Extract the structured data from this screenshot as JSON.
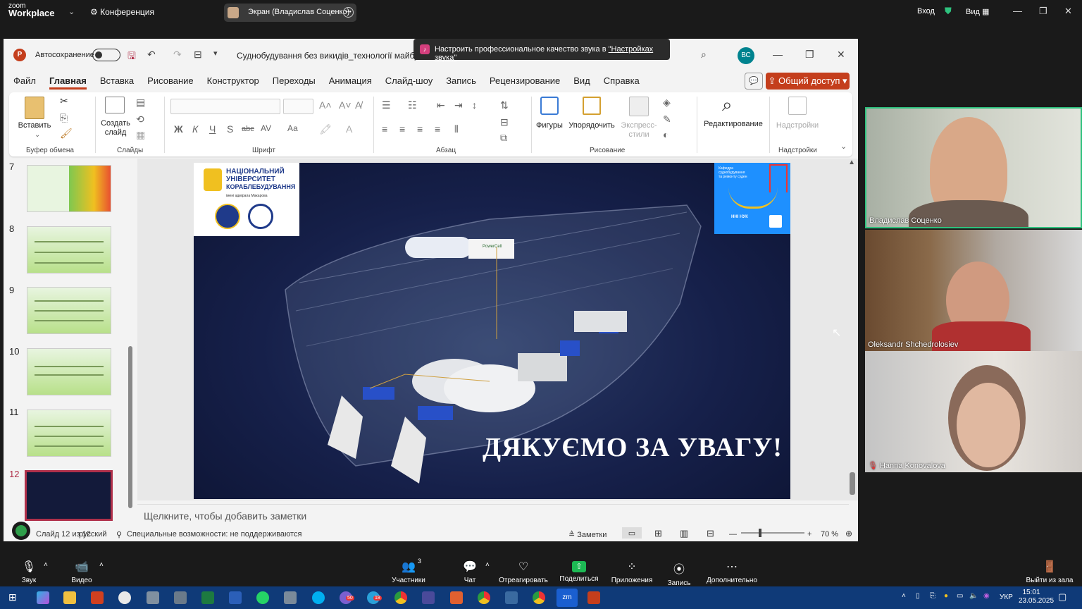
{
  "zoom": {
    "logo_top": "zoom",
    "logo_bottom": "Workplace",
    "meeting_label": "Конференция",
    "screen_share_label": "Экран (Владислав Соценко)",
    "login": "Вход",
    "view": "Вид"
  },
  "toast": {
    "prefix": "Настроить профессиональное качество звука в ",
    "link": "\"Настройках звука\""
  },
  "ppt": {
    "autosave_label": "Автосохранение",
    "doc_title": "Суднобудування без викидів_технології майбутнь...",
    "user_initials": "ВС",
    "menu": [
      "Файл",
      "Главная",
      "Вставка",
      "Рисование",
      "Конструктор",
      "Переходы",
      "Анимация",
      "Слайд-шоу",
      "Запись",
      "Рецензирование",
      "Вид",
      "Справка"
    ],
    "share_button": "Общий доступ",
    "ribbon": {
      "paste": "Вставить",
      "clipboard_group": "Буфер обмена",
      "new_slide": "Создать слайд",
      "slides_group": "Слайды",
      "font_group": "Шрифт",
      "paragraph_group": "Абзац",
      "shapes": "Фигуры",
      "arrange": "Упорядочить",
      "quick_styles": "Экспресс-стили",
      "drawing_group": "Рисование",
      "editing": "Редактирование",
      "addins": "Надстройки",
      "addins_group": "Надстройки",
      "bold": "Ж",
      "italic": "К",
      "underline": "Ч",
      "shadow": "S",
      "strike": "abc",
      "spacing": "AV",
      "case": "Аа"
    },
    "slide_numbers": [
      "7",
      "8",
      "9",
      "10",
      "11",
      "12"
    ],
    "slide": {
      "uni_line1": "НАЦІОНАЛЬНИЙ",
      "uni_line2": "УНІВЕРСИТЕТ",
      "uni_line3": "КОРАБЛЕБУДУВАННЯ",
      "uni_sub": "імені адмірала Макарова",
      "kaf_line1": "Кафедра",
      "kaf_line2": "суднобудування",
      "kaf_line3": "та ремонту суден",
      "kaf_badge": "ННІ НУК",
      "thanks": "ДЯКУЄМО ЗА УВАГУ!",
      "brand1": "PowerCell"
    },
    "notes_placeholder": "Щелкните, чтобы добавить заметки",
    "status": {
      "slide_counter": "Слайд 12 из 12",
      "language": "русский",
      "accessibility": "Специальные возможности: не поддерживаются",
      "notes": "Заметки",
      "zoom_level": "70 %"
    }
  },
  "participants": [
    {
      "name": "Владислав Соценко"
    },
    {
      "name": "Oleksandr Shchedrolosiev"
    },
    {
      "name": "Hanna Konovalova"
    }
  ],
  "toolbar": {
    "audio": "Звук",
    "video": "Видео",
    "participants": "Участники",
    "participants_count": "3",
    "chat": "Чат",
    "react": "Отреагировать",
    "share": "Поделиться",
    "apps": "Приложения",
    "record": "Запись",
    "more": "Дополнительно",
    "leave": "Выйти из зала"
  },
  "taskbar": {
    "lang": "УКР",
    "time": "15:01",
    "date": "23.05.2025",
    "badge1": "50",
    "badge2": "18"
  },
  "colors": {
    "ppt_accent": "#c43e1c",
    "zoom_active_speaker": "#2ec27e",
    "taskbar_bg": "#0f3a78",
    "slide_bg": "#16204a"
  }
}
